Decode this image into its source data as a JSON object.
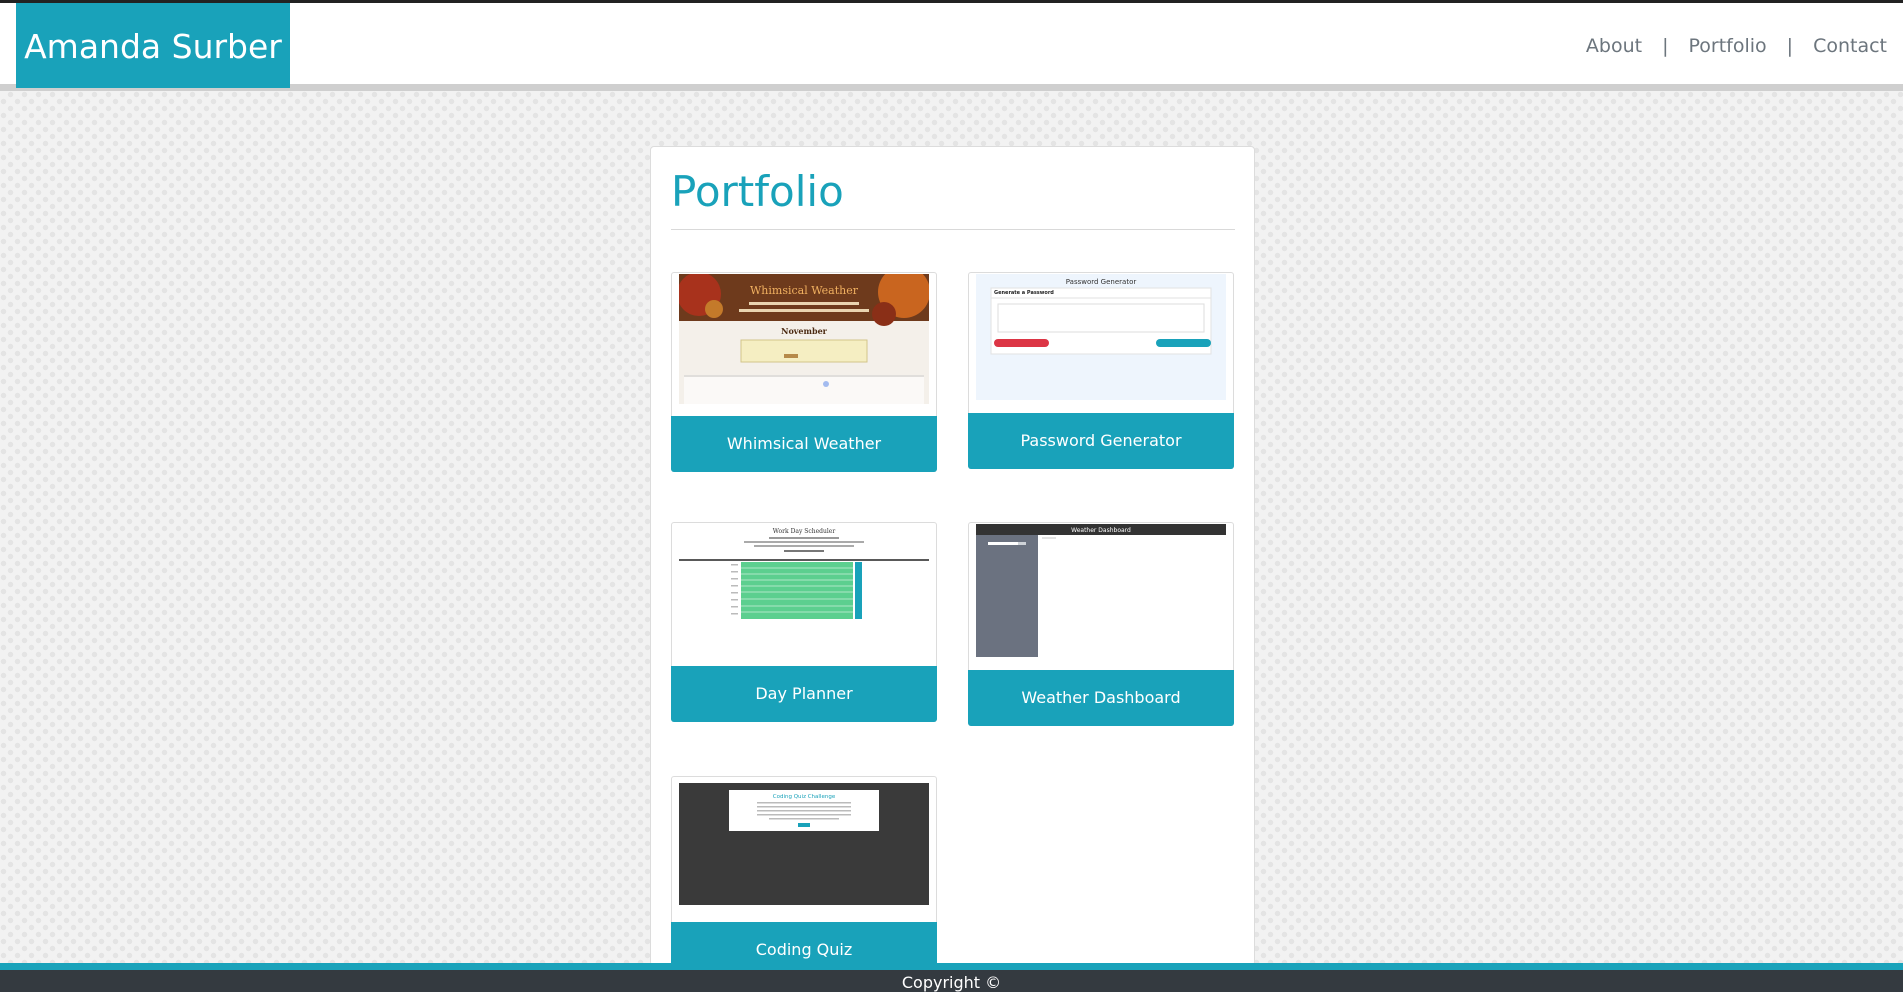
{
  "header": {
    "brand": "Amanda Surber",
    "nav": [
      "About",
      "Portfolio",
      "Contact"
    ],
    "separator": "|"
  },
  "main": {
    "title": "Portfolio",
    "projects": [
      {
        "label": "Whimsical Weather",
        "thumb": {
          "title": "Whimsical Weather",
          "month": "November"
        }
      },
      {
        "label": "Password Generator",
        "thumb": {
          "title": "Password Generator",
          "subtitle": "Generate a Password"
        }
      },
      {
        "label": "Day Planner",
        "thumb": {
          "title": "Work Day Scheduler"
        }
      },
      {
        "label": "Weather Dashboard",
        "thumb": {
          "title": "Weather Dashboard"
        }
      },
      {
        "label": "Coding Quiz",
        "thumb": {
          "title": "Coding Quiz Challenge"
        }
      }
    ]
  },
  "footer": {
    "text": "Copyright ©"
  },
  "colors": {
    "accent": "#19a2ba",
    "footer_bg": "#343a40",
    "planner_green": "#5ccf8f",
    "dashboard_sidebar": "#6b7280",
    "red": "#dc3545"
  }
}
